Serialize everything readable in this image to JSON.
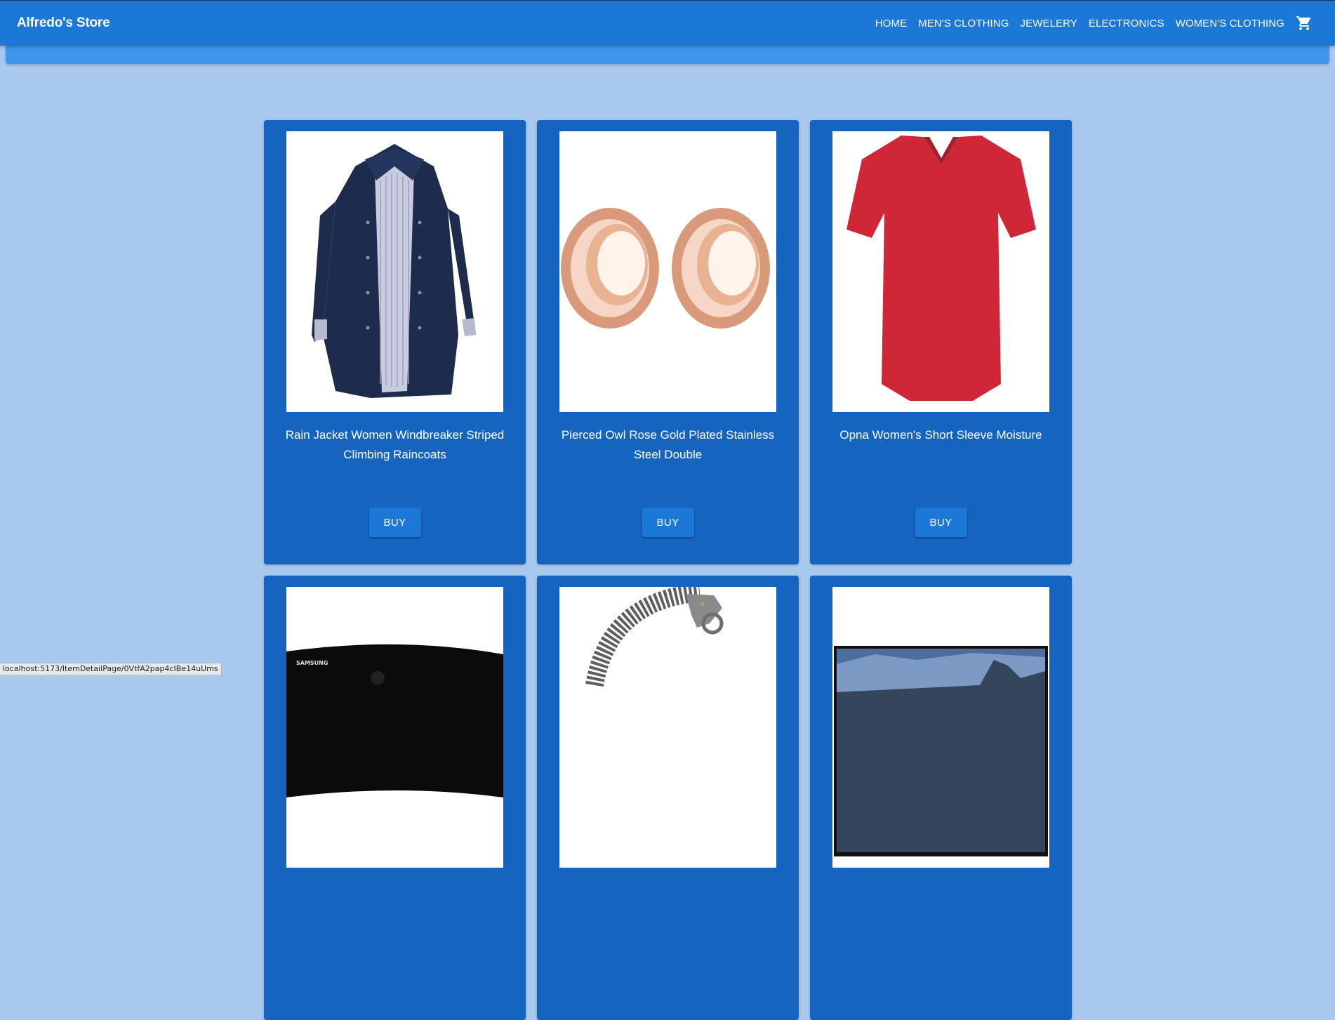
{
  "header": {
    "brand": "Alfredo's Store",
    "nav": [
      "HOME",
      "MEN'S CLOTHING",
      "JEWELERY",
      "ELECTRONICS",
      "WOMEN'S CLOTHING"
    ],
    "cart_icon": "shopping-cart-icon"
  },
  "products": [
    {
      "title": "Rain Jacket Women Windbreaker Striped Climbing Raincoats",
      "button": "BUY",
      "image": "navy-rain-jacket"
    },
    {
      "title": "Pierced Owl Rose Gold Plated Stainless Steel Double",
      "button": "BUY",
      "image": "rose-gold-ear-tunnels"
    },
    {
      "title": "Opna Women's Short Sleeve Moisture",
      "button": "BUY",
      "image": "red-v-neck-tshirt"
    },
    {
      "title": "",
      "button": "",
      "image": "samsung-curved-monitor"
    },
    {
      "title": "",
      "button": "",
      "image": "dragon-chain-bracelet"
    },
    {
      "title": "",
      "button": "",
      "image": "landscape-monitor"
    }
  ],
  "status_bar": {
    "url": "localhost:5173/ItemDetailPage/0VtfA2pap4cIBe14uUms"
  },
  "colors": {
    "page_bg": "#a8c8ee",
    "appbar": "#1b78d6",
    "card": "#1565c0",
    "subbar": "#3e95ec"
  }
}
